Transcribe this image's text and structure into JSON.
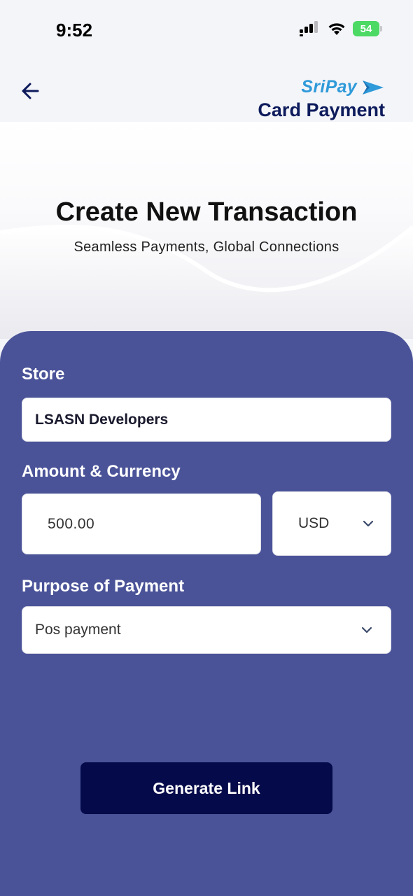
{
  "status_bar": {
    "time": "9:52",
    "battery": "54",
    "icons": [
      "signal-icon",
      "wifi-icon",
      "battery-icon"
    ]
  },
  "header": {
    "back_icon": "arrow-left-icon",
    "brand_name": "SriPay",
    "brand_icon": "play-arrow-icon",
    "title": "Card Payment"
  },
  "hero": {
    "title": "Create New Transaction",
    "subtitle": "Seamless Payments, Global Connections"
  },
  "form": {
    "store": {
      "label": "Store",
      "value": "LSASN Developers"
    },
    "amount": {
      "label": "Amount & Currency",
      "value": "500.00",
      "currency": "USD"
    },
    "purpose": {
      "label": "Purpose of Payment",
      "value": "Pos payment"
    },
    "submit_label": "Generate Link"
  },
  "colors": {
    "panel": "#4a5398",
    "button": "#050a4a",
    "brand_blue": "#2f9ad9",
    "title_navy": "#0d1b5c"
  }
}
